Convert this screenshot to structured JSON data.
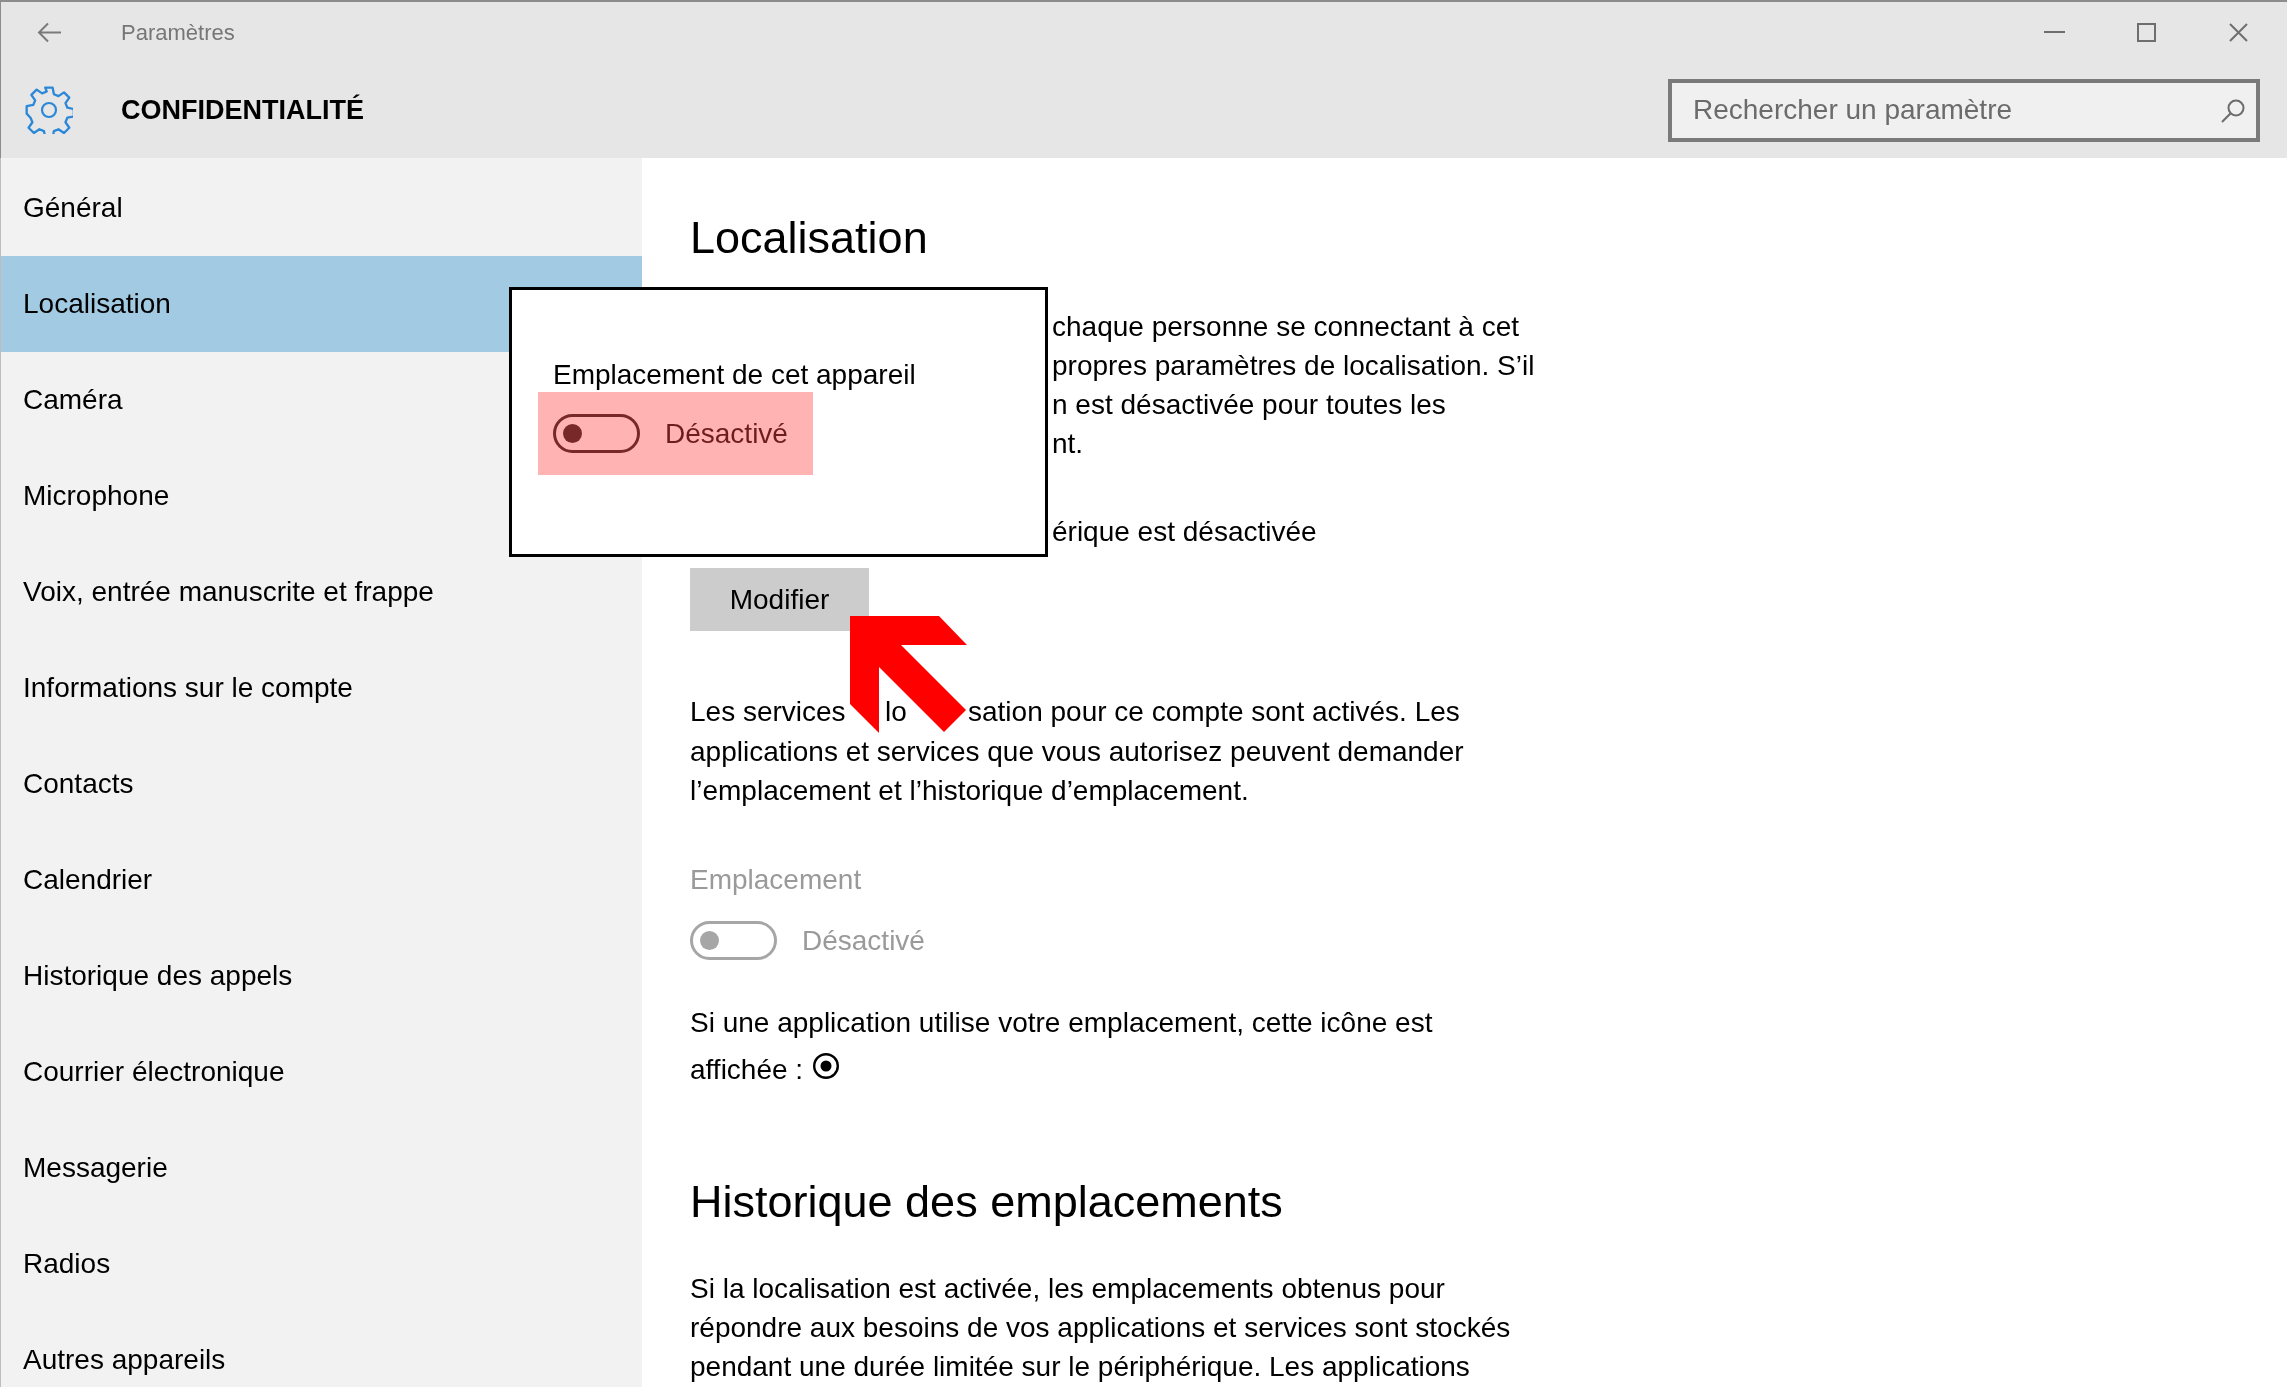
{
  "window": {
    "title": "Paramètres"
  },
  "header": {
    "title": "CONFIDENTIALITÉ",
    "search": {
      "placeholder": "Rechercher un paramètre"
    }
  },
  "sidebar": {
    "items": [
      {
        "label": "Général",
        "selected": false
      },
      {
        "label": "Localisation",
        "selected": true
      },
      {
        "label": "Caméra",
        "selected": false
      },
      {
        "label": "Microphone",
        "selected": false
      },
      {
        "label": "Voix, entrée manuscrite et frappe",
        "selected": false
      },
      {
        "label": "Informations sur le compte",
        "selected": false
      },
      {
        "label": "Contacts",
        "selected": false
      },
      {
        "label": "Calendrier",
        "selected": false
      },
      {
        "label": "Historique des appels",
        "selected": false
      },
      {
        "label": "Courrier électronique",
        "selected": false
      },
      {
        "label": "Messagerie",
        "selected": false
      },
      {
        "label": "Radios",
        "selected": false
      },
      {
        "label": "Autres appareils",
        "selected": false
      }
    ]
  },
  "content": {
    "heading": "Localisation",
    "intro_visible_lines": [
      "chaque personne se connectant à cet",
      "propres paramètres de localisation. S’il",
      "n est désactivée pour toutes les",
      "nt."
    ],
    "status_visible_text": "érique est désactivée",
    "change_button": "Modifier",
    "services_first_line_visible": [
      "Les services",
      "lo",
      "sation pour ce compte sont activés. Les"
    ],
    "services_rest": "applications et services que vous autorisez peuvent demander l’emplacement et l’historique d’emplacement.",
    "location_setting": {
      "label": "Emplacement",
      "state_text": "Désactivé",
      "on": false,
      "disabled": true
    },
    "icon_note_lines": [
      "Si une application utilise votre emplacement, cette icône est",
      "affichée :"
    ],
    "history_heading": "Historique des emplacements",
    "history_text": "Si la localisation est activée, les emplacements obtenus pour répondre aux besoins de vos applications et services sont stockés pendant une durée limitée sur le périphérique. Les applications"
  },
  "callout": {
    "label": "Emplacement de cet appareil",
    "highlighted": true,
    "toggle": {
      "state_text": "Désactivé",
      "on": false
    }
  }
}
